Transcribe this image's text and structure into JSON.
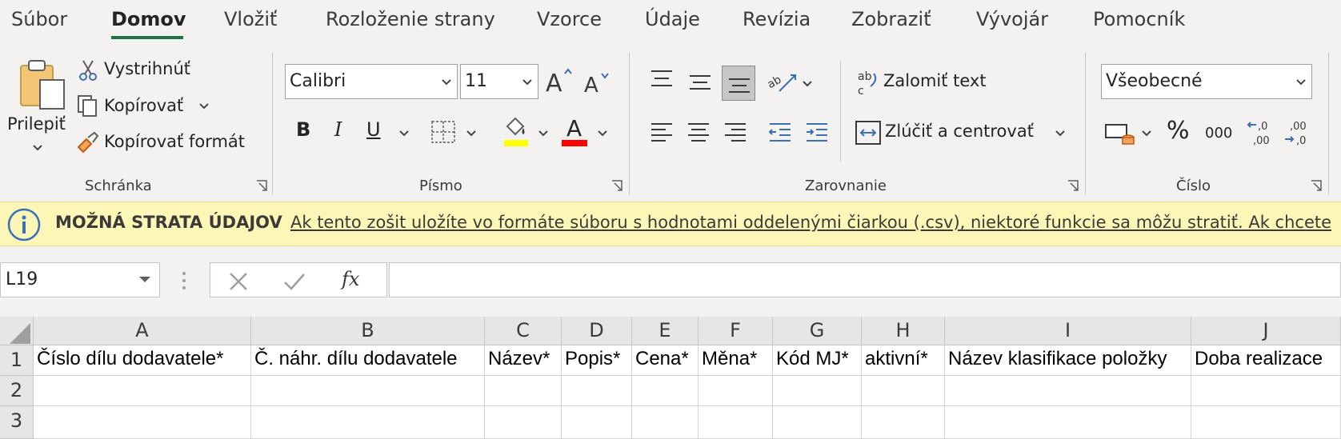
{
  "tabs": [
    "Súbor",
    "Domov",
    "Vložiť",
    "Rozloženie strany",
    "Vzorce",
    "Údaje",
    "Revízia",
    "Zobraziť",
    "Vývojár",
    "Pomocník"
  ],
  "ribbon": {
    "clipboard": {
      "paste": "Prilepiť",
      "cut": "Vystrihnúť",
      "copy": "Kopírovať",
      "format_painter": "Kopírovať formát",
      "group": "Schránka"
    },
    "font": {
      "name": "Calibri",
      "size": "11",
      "bold": "B",
      "italic": "I",
      "underline": "U",
      "font_color_glyph": "A",
      "group": "Písmo",
      "highlight_color": "#ffff00",
      "font_color": "#ff0000"
    },
    "alignment": {
      "wrap_text": "Zalomiť text",
      "merge_center": "Zlúčiť a centrovať",
      "group": "Zarovnanie"
    },
    "number": {
      "format": "Všeobecné",
      "percent": "%",
      "thousands": "000",
      "group": "Číslo"
    }
  },
  "infobar": {
    "title": "MOŽNÁ STRATA ÚDAJOV",
    "message": "Ak tento zošit uložíte vo formáte súboru s hodnotami oddelenými čiarkou (.csv), niektoré funkcie sa môžu stratiť. Ak chcete"
  },
  "formula_bar": {
    "name_box": "L19",
    "fx": "fx",
    "formula": ""
  },
  "sheet": {
    "columns": [
      "A",
      "B",
      "C",
      "D",
      "E",
      "F",
      "G",
      "H",
      "I",
      "J"
    ],
    "rows": [
      "1",
      "2",
      "3"
    ],
    "row1": [
      "Číslo dílu dodavatele*",
      "Č. náhr. dílu dodavatele",
      "Název*",
      "Popis*",
      "Cena*",
      "Měna*",
      "Kód MJ*",
      "aktivní*",
      "Název klasifikace položky",
      "Doba realizace"
    ]
  }
}
